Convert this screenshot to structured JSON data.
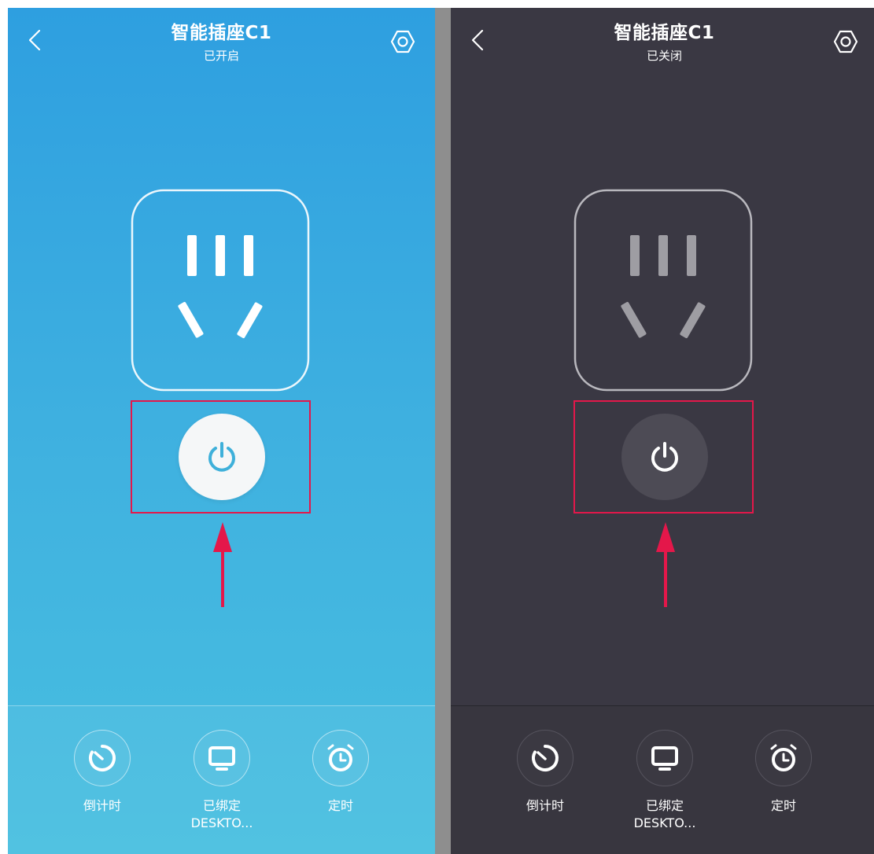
{
  "colors": {
    "on_bg_top": "#2e9fe0",
    "on_bg_bottom": "#48bfe0",
    "off_bg": "#3a3843",
    "highlight": "#e4174a",
    "power_icon_on": "#3eb0da",
    "power_icon_off": "#ffffff"
  },
  "panels": [
    {
      "state": "on",
      "header": {
        "title": "智能插座C1",
        "status": "已开启"
      },
      "toolbar": [
        {
          "label": "倒计时",
          "icon": "countdown-icon"
        },
        {
          "label": "已绑定",
          "sub": "DESKTO...",
          "icon": "monitor-icon"
        },
        {
          "label": "定时",
          "icon": "alarm-clock-icon"
        }
      ]
    },
    {
      "state": "off",
      "header": {
        "title": "智能插座C1",
        "status": "已关闭"
      },
      "toolbar": [
        {
          "label": "倒计时",
          "icon": "countdown-icon"
        },
        {
          "label": "已绑定",
          "sub": "DESKTO...",
          "icon": "monitor-icon"
        },
        {
          "label": "定时",
          "icon": "alarm-clock-icon"
        }
      ]
    }
  ]
}
